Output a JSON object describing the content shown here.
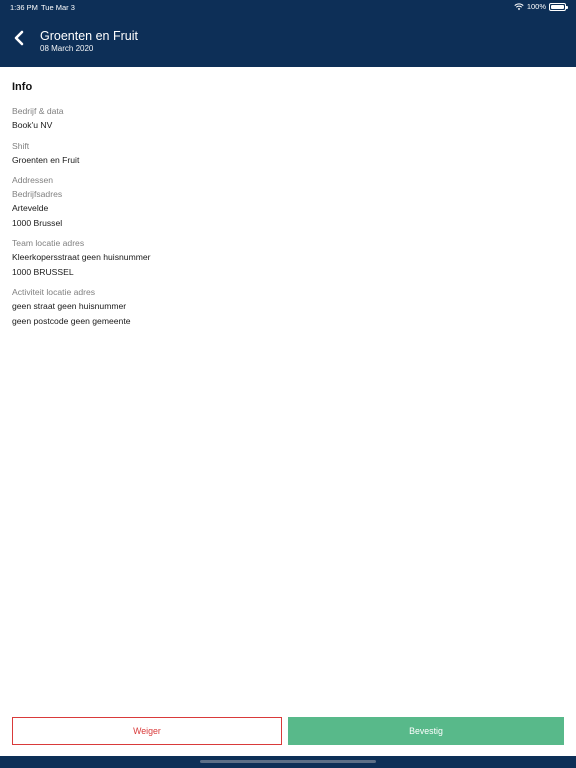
{
  "status_bar": {
    "time": "1:36 PM",
    "date": "Tue Mar 3",
    "battery": "100%"
  },
  "header": {
    "title": "Groenten en Fruit",
    "subtitle": "08 March 2020"
  },
  "info": {
    "section_title": "Info",
    "company": {
      "label": "Bedrijf & data",
      "value": "Book'u NV"
    },
    "shift": {
      "label": "Shift",
      "value": "Groenten en Fruit"
    },
    "addresses_label": "Addressen",
    "company_address": {
      "label": "Bedrijfsadres",
      "line1": "Artevelde",
      "line2": "1000 Brussel"
    },
    "team_location": {
      "label": "Team locatie adres",
      "line1": "Kleerkopersstraat geen huisnummer",
      "line2": "1000 BRUSSEL"
    },
    "activity_location": {
      "label": "Activiteit locatie adres",
      "line1": "geen straat geen huisnummer",
      "line2": "geen postcode geen gemeente"
    }
  },
  "actions": {
    "decline_label": "Weiger",
    "confirm_label": "Bevestig"
  },
  "colors": {
    "header_bg": "#0d2f57",
    "decline": "#d93a3a",
    "confirm": "#58b98a"
  },
  "icons": {
    "back": "chevron-left-icon",
    "wifi": "wifi-icon",
    "battery": "battery-icon"
  }
}
